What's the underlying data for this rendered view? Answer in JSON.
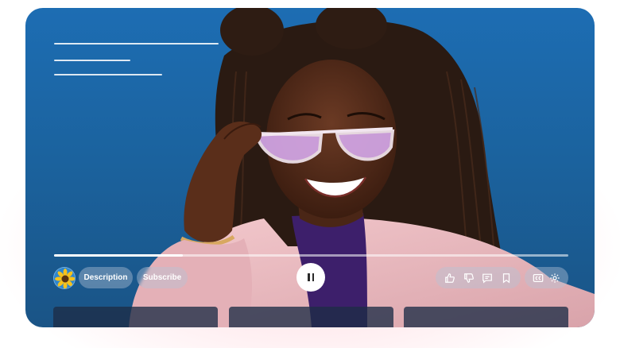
{
  "player": {
    "progress": 0.25,
    "channel_avatar": "sunflower-avatar",
    "description_label": "Description",
    "subscribe_label": "Subscribe",
    "play_state": "playing",
    "actions": [
      {
        "icon": "thumbs-up-icon"
      },
      {
        "icon": "thumbs-down-icon"
      },
      {
        "icon": "comment-icon"
      },
      {
        "icon": "bookmark-icon"
      }
    ],
    "settings": [
      {
        "icon": "closed-captions-icon"
      },
      {
        "icon": "gear-icon"
      }
    ]
  },
  "colors": {
    "background_top": "#1d6db3",
    "background_bottom": "#1a5486",
    "jacket": "#e9b7bd",
    "glow": "#ff8fa3"
  }
}
